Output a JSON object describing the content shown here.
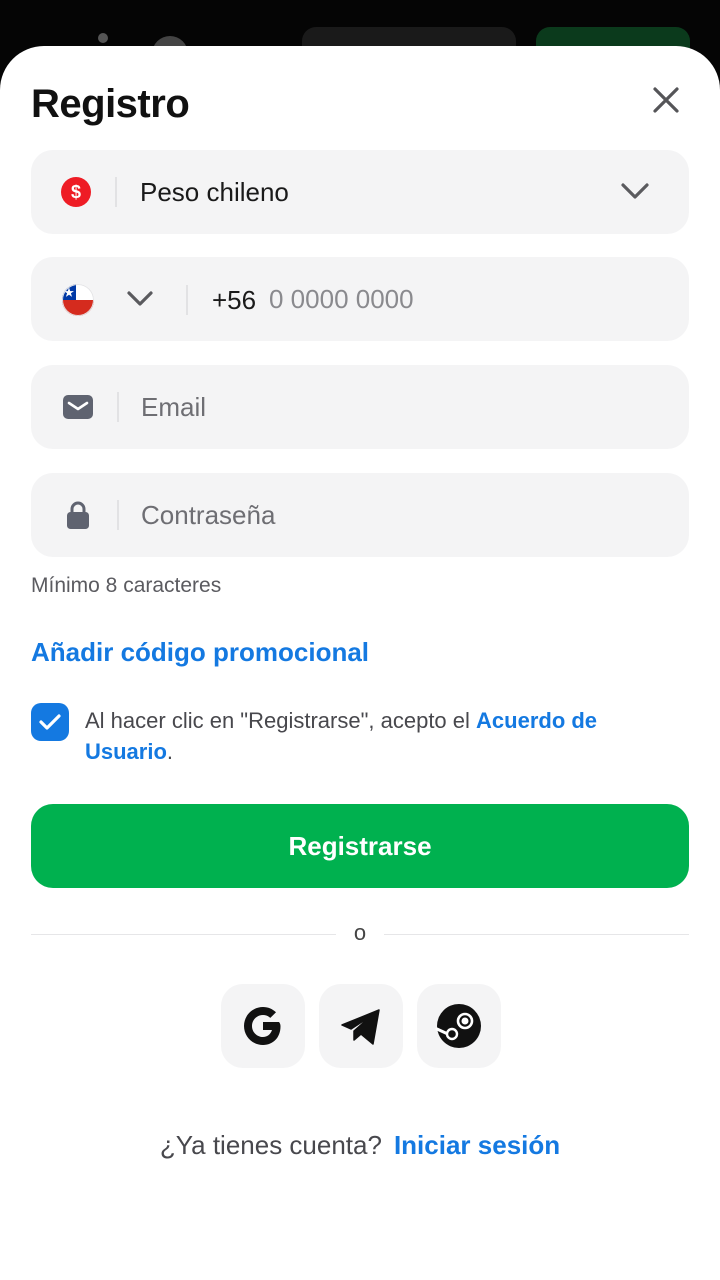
{
  "title": "Registro",
  "currency": {
    "symbol": "$",
    "label": "Peso chileno",
    "icon": "chevron-down-icon"
  },
  "phone": {
    "code": "+56",
    "placeholder": "0 0000 0000",
    "country_flag": "chile-flag-icon"
  },
  "email": {
    "placeholder": "Email",
    "icon": "envelope-icon"
  },
  "password": {
    "placeholder": "Contraseña",
    "icon": "lock-icon",
    "hint": "Mínimo 8 caracteres"
  },
  "promo_link": "Añadir código promocional",
  "agreement": {
    "checked": true,
    "text": "Al hacer clic en \"Registrarse\", acepto el ",
    "link": "Acuerdo de Usuario",
    "suffix": "."
  },
  "register_button": "Registrarse",
  "divider_text": "o",
  "social": [
    "google-icon",
    "telegram-icon",
    "steam-icon"
  ],
  "login": {
    "question": "¿Ya tienes cuenta?",
    "link": "Iniciar sesión"
  },
  "colors": {
    "accent_blue": "#1479e1",
    "primary_green": "#00b14f",
    "field_bg": "#f4f4f5",
    "currency_red": "#ee1c25"
  }
}
